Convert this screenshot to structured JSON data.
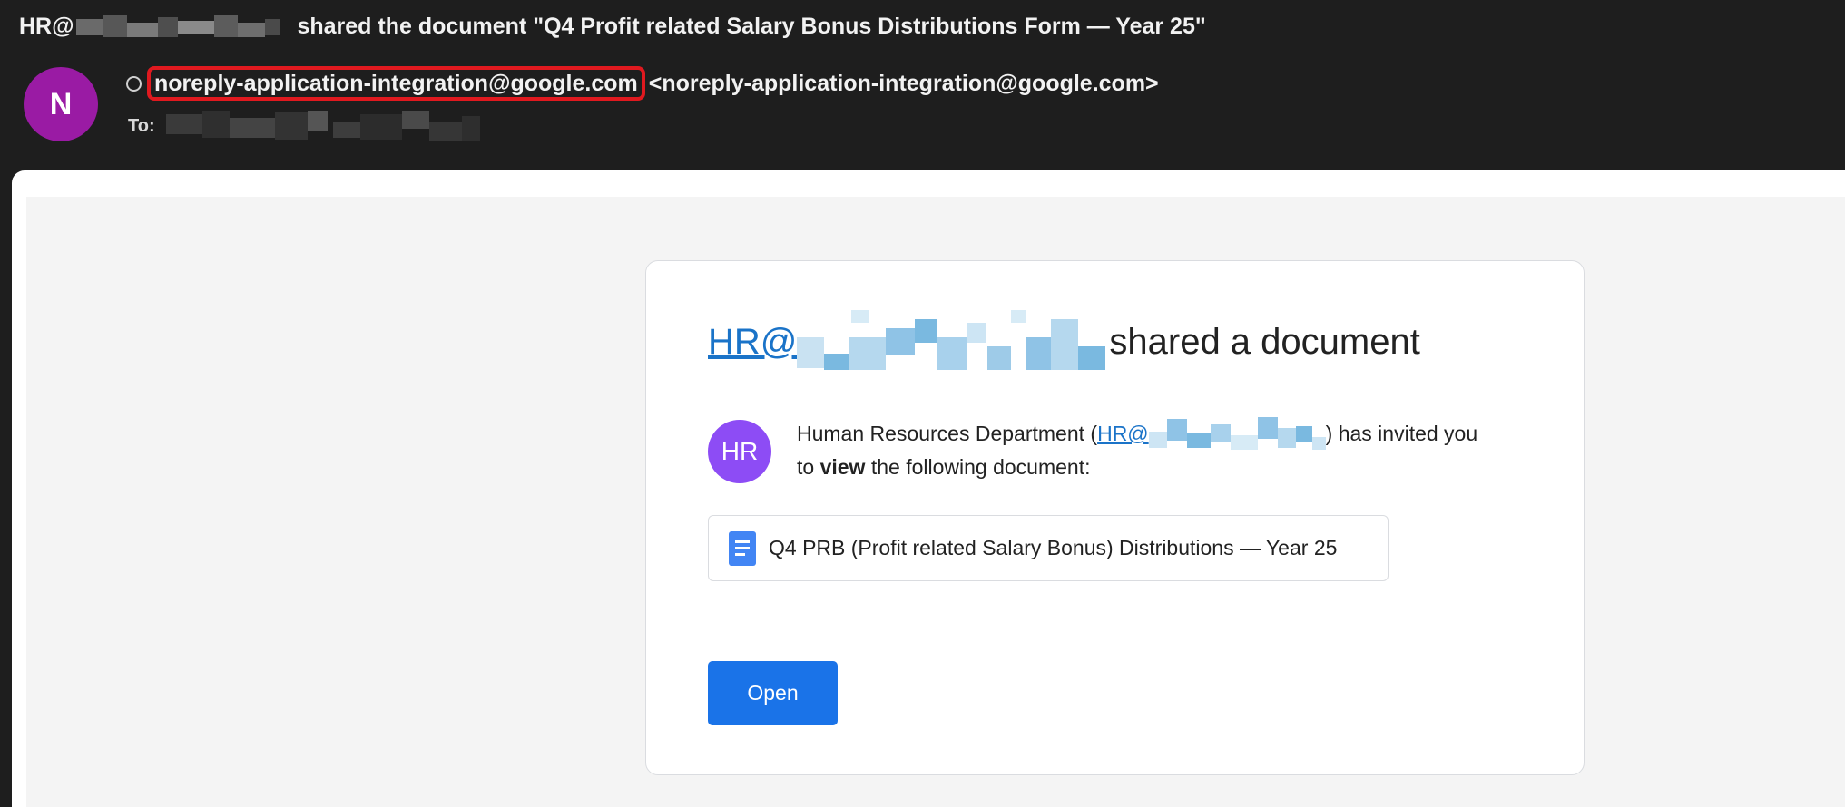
{
  "header": {
    "subject_prefix": "HR@",
    "subject_rest": "shared  the document \"Q4 Profit related Salary Bonus Distributions Form — Year 25\"",
    "sender_initial": "N",
    "sender_name": "noreply-application-integration@google.com",
    "sender_email": "<noreply-application-integration@google.com>",
    "to_label": "To:"
  },
  "card": {
    "title_link": "HR@",
    "title_rest": "shared a document",
    "avatar_initials": "HR",
    "invite_prefix": "Human Resources Department (",
    "invite_link": "HR@",
    "invite_suffix": ") has invited you",
    "invite_line2_a": "to",
    "invite_line2_bold": "view",
    "invite_line2_b": "the following document:",
    "doc_name": "Q4 PRB (Profit related Salary Bonus) Distributions — Year 25",
    "open_label": "Open"
  },
  "colors": {
    "header_bg": "#1e1e1e",
    "sender_avatar": "#9a1ba4",
    "hr_avatar": "#8d4cf5",
    "highlight_box": "#e0191f",
    "link": "#1a73c8",
    "open_button": "#1a73e8"
  },
  "icons": {
    "doc": "google-docs-icon",
    "status": "status-circle-icon"
  }
}
